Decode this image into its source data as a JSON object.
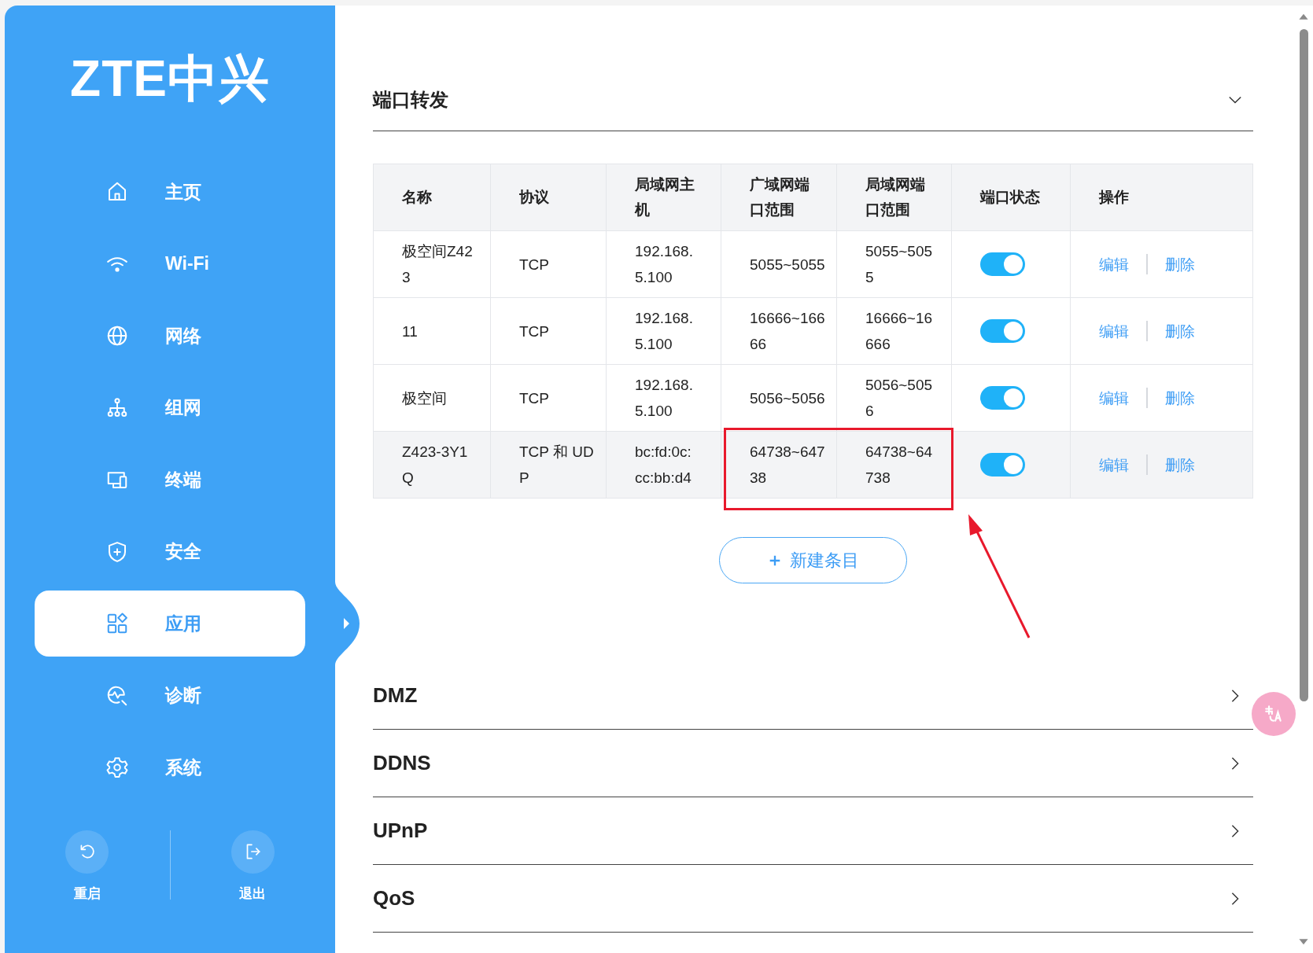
{
  "logo": "ZTE中兴",
  "nav": [
    {
      "label": "主页",
      "selected": false
    },
    {
      "label": "Wi-Fi",
      "selected": false
    },
    {
      "label": "网络",
      "selected": false
    },
    {
      "label": "组网",
      "selected": false
    },
    {
      "label": "终端",
      "selected": false
    },
    {
      "label": "安全",
      "selected": false
    },
    {
      "label": "应用",
      "selected": true
    },
    {
      "label": "诊断",
      "selected": false
    },
    {
      "label": "系统",
      "selected": false
    }
  ],
  "footer_actions": [
    {
      "label": "重启"
    },
    {
      "label": "退出"
    }
  ],
  "sections": [
    {
      "title": "端口转发",
      "expanded": true,
      "table": {
        "columns": [
          "名称",
          "协议",
          "局域网主机",
          "广域网端口范围",
          "局域网端口范围",
          "端口状态",
          "操作"
        ],
        "rows": [
          {
            "cells": [
              "极空间Z423",
              "TCP",
              "192.168.5.100",
              "5055~5055",
              "5055~5055"
            ],
            "on": true,
            "actions": [
              "编辑",
              "删除"
            ],
            "hovered": false
          },
          {
            "cells": [
              "11",
              "TCP",
              "192.168.5.100",
              "16666~16666",
              "16666~16666"
            ],
            "on": true,
            "actions": [
              "编辑",
              "删除"
            ],
            "hovered": false
          },
          {
            "cells": [
              "极空间",
              "TCP",
              "192.168.5.100",
              "5056~5056",
              "5056~5056"
            ],
            "on": true,
            "actions": [
              "编辑",
              "删除"
            ],
            "hovered": false
          },
          {
            "cells": [
              "Z423-3Y1Q",
              "TCP 和 UDP",
              "bc:fd:0c:cc:bb:d4",
              "64738~64738",
              "64738~64738"
            ],
            "on": true,
            "actions": [
              "编辑",
              "删除"
            ],
            "hovered": true
          }
        ]
      },
      "add_button": "新建条目"
    },
    {
      "title": "DMZ",
      "expanded": false
    },
    {
      "title": "DDNS",
      "expanded": false
    },
    {
      "title": "UPnP",
      "expanded": false
    },
    {
      "title": "QoS",
      "expanded": false
    }
  ]
}
